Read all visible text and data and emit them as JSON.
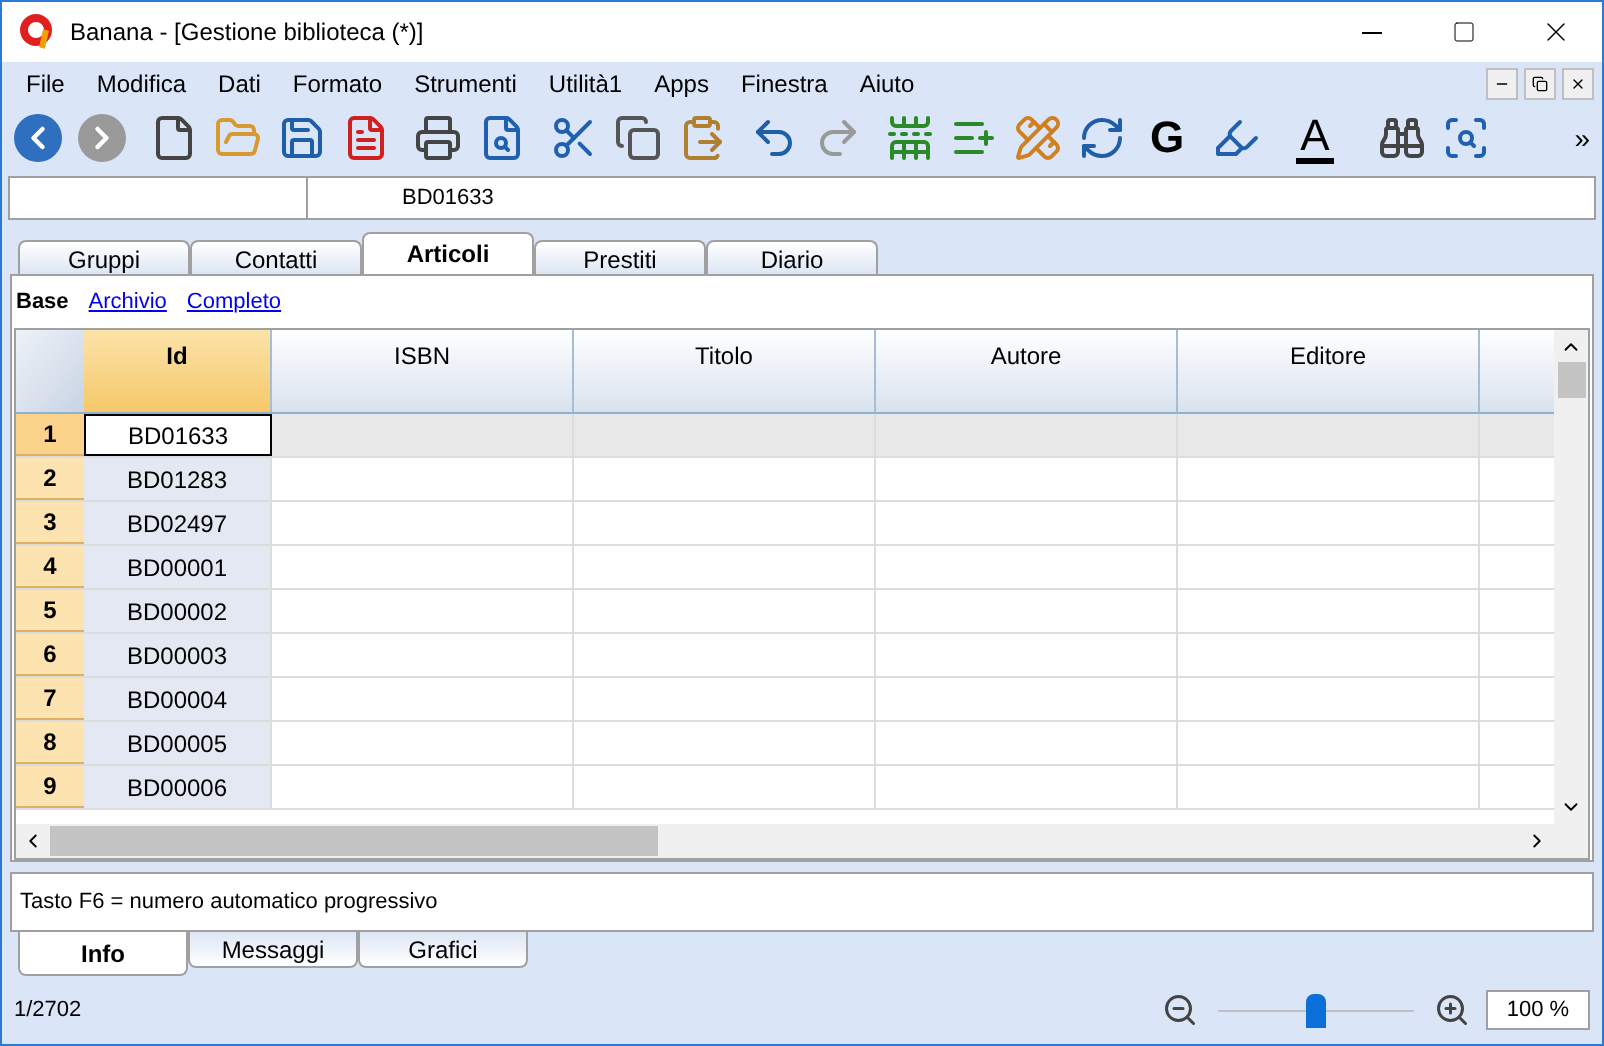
{
  "window": {
    "title": "Banana - [Gestione biblioteca (*)]"
  },
  "menu": [
    "File",
    "Modifica",
    "Dati",
    "Formato",
    "Strumenti",
    "Utilità1",
    "Apps",
    "Finestra",
    "Aiuto"
  ],
  "toolbar": {
    "bold_label": "G",
    "font_color_label": "A",
    "more": "»"
  },
  "cell_bar": {
    "value": "BD01633"
  },
  "tabs": [
    {
      "label": "Gruppi",
      "selected": false
    },
    {
      "label": "Contatti",
      "selected": false
    },
    {
      "label": "Articoli",
      "selected": true
    },
    {
      "label": "Prestiti",
      "selected": false
    },
    {
      "label": "Diario",
      "selected": false
    }
  ],
  "views": [
    {
      "label": "Base",
      "selected": true
    },
    {
      "label": "Archivio",
      "selected": false
    },
    {
      "label": "Completo",
      "selected": false
    }
  ],
  "table": {
    "columns": [
      "Id",
      "ISBN",
      "Titolo",
      "Autore",
      "Editore"
    ],
    "rows": [
      {
        "number": "1",
        "id": "BD01633",
        "selected": true
      },
      {
        "number": "2",
        "id": "BD01283",
        "selected": false
      },
      {
        "number": "3",
        "id": "BD02497",
        "selected": false
      },
      {
        "number": "4",
        "id": "BD00001",
        "selected": false
      },
      {
        "number": "5",
        "id": "BD00002",
        "selected": false
      },
      {
        "number": "6",
        "id": "BD00003",
        "selected": false
      },
      {
        "number": "7",
        "id": "BD00004",
        "selected": false
      },
      {
        "number": "8",
        "id": "BD00005",
        "selected": false
      },
      {
        "number": "9",
        "id": "BD00006",
        "selected": false
      }
    ]
  },
  "info": {
    "text": "Tasto F6 = numero automatico progressivo"
  },
  "bottom_tabs": [
    {
      "label": "Info",
      "selected": true
    },
    {
      "label": "Messaggi",
      "selected": false
    },
    {
      "label": "Grafici",
      "selected": false
    }
  ],
  "status_bar": {
    "position": "1/2702",
    "zoom": {
      "level": 0.5,
      "reading": "100 %"
    }
  }
}
